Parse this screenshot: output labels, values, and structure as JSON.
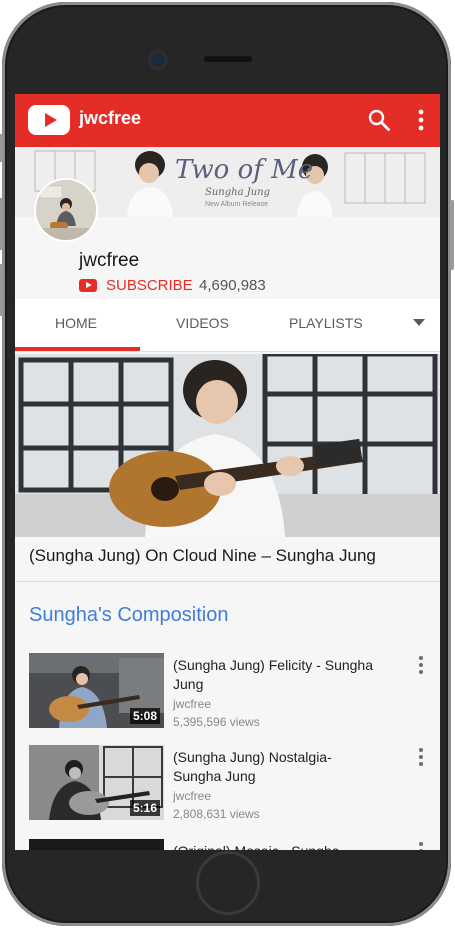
{
  "app": {
    "title": "jwcfree"
  },
  "banner": {
    "title": "Two of Me",
    "subtitle": "Sungha Jung",
    "tag": "New Album Release"
  },
  "channel": {
    "name": "jwcfree",
    "subscribe_label": "SUBSCRIBE",
    "subscriber_count": "4,690,983"
  },
  "tabs": [
    {
      "label": "HOME",
      "active": true
    },
    {
      "label": "VIDEOS"
    },
    {
      "label": "PLAYLISTS"
    }
  ],
  "featured": {
    "title": "(Sungha Jung) On Cloud Nine – Sungha Jung"
  },
  "section": {
    "title": "Sungha's Composition",
    "videos": [
      {
        "title": "(Sungha Jung) Felicity - Sungha Jung",
        "channel": "jwcfree",
        "views": "5,395,596 views",
        "duration": "5:08"
      },
      {
        "title": "(Sungha Jung) Nostalgia- Sungha Jung",
        "channel": "jwcfree",
        "views": "2,808,631 views",
        "duration": "5:16"
      },
      {
        "title": "(Original) Mosaic - Sungha"
      }
    ]
  },
  "colors": {
    "accent": "#e52d27",
    "link": "#3f7ed6"
  }
}
